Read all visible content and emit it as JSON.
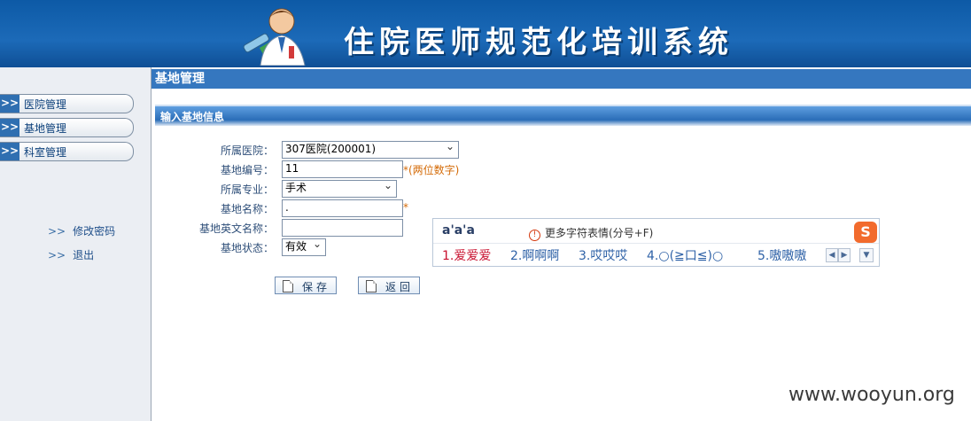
{
  "header": {
    "title": "住院医师规范化培训系统",
    "logo_icon": "doctor-icon"
  },
  "sidebar": {
    "items": [
      {
        "label": "医院管理"
      },
      {
        "label": "基地管理"
      },
      {
        "label": "科室管理"
      }
    ],
    "links": [
      {
        "label": "修改密码"
      },
      {
        "label": "退出"
      }
    ],
    "chevron": ">>"
  },
  "page": {
    "title": "基地管理",
    "section_title": "输入基地信息"
  },
  "form": {
    "hospital": {
      "label": "所属医院：",
      "value": "307医院(200001)"
    },
    "code": {
      "label": "基地编号：",
      "value": "11",
      "note": "*(两位数字)"
    },
    "major": {
      "label": "所属专业：",
      "value": "手术"
    },
    "name": {
      "label": "基地名称：",
      "value": ".",
      "note": "*"
    },
    "english_name": {
      "label": "基地英文名称：",
      "value": ""
    },
    "status": {
      "label": "基地状态：",
      "value": "有效"
    },
    "save_label": "保存",
    "back_label": "返回"
  },
  "ime": {
    "composition": "a'a'a",
    "more_symbols": "更多字符表情(分号+F)",
    "candidates": [
      "1.爱爱爱",
      "2.啊啊啊",
      "3.哎哎哎",
      "4.○(≧口≦)○",
      "5.嗷嗷嗷"
    ],
    "logo_letter": "S"
  },
  "watermark": "www.wooyun.org",
  "colors": {
    "header_blue": "#1c6ab8",
    "page_header": "#3577bf",
    "required_note": "#d46b08",
    "candidate_first": "#c8102e"
  }
}
